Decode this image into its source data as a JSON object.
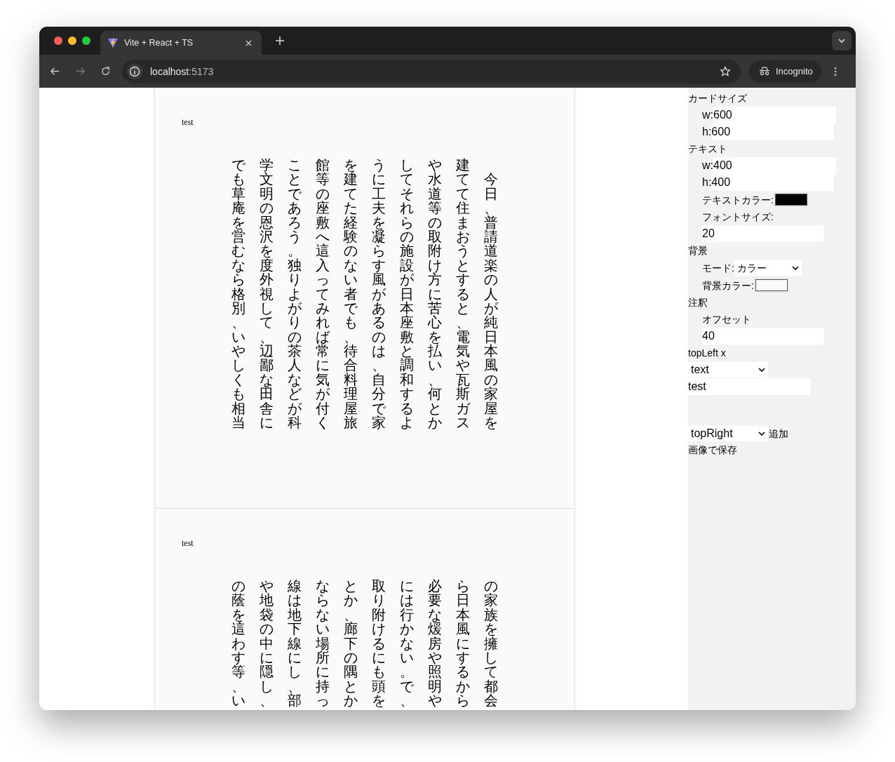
{
  "browser": {
    "tab_title": "Vite + React + TS",
    "url_host": "localhost",
    "url_port": ":5173",
    "profile": "Incognito"
  },
  "cards": [
    {
      "label": "test",
      "columns": [
        "でも草庵を営むなら格別、いやしくも相当",
        "学文明の恩沢を度外視して、辺鄙な田舎に",
        "ことであろう。独りよがりの茶人などが科",
        "館等の座敷へ這入ってみれば常に気が付く",
        "を建てた経験のない者でも、待合料理屋旅",
        "うに工夫を凝らす風があるのは、自分で家",
        "してそれらの施設が日本座敷と調和するよ",
        "や水道等の取附け方に苦心を払い、何とか",
        "建てて住まおうとすると、電気や瓦斯ガス",
        "　今日、普請道楽の人が純日本風の家屋を"
      ]
    },
    {
      "label": "test",
      "columns": [
        "の蔭を這わす等、い",
        "や地袋の中に隠し、",
        "線は地下線にし、部",
        "ならない場所に持っ",
        "とか、廊下の隅とか",
        "取り附けるにも頭を",
        "には行かない。で、",
        "必要な煖房や照明や",
        "ら日本風にするから",
        "の家族を擁して都会"
      ]
    }
  ],
  "panel": [
    {
      "kind": "heading",
      "text": "カードサイズ"
    },
    {
      "kind": "field",
      "label": "w:",
      "value": "600"
    },
    {
      "kind": "field",
      "label": "h:",
      "value": "600"
    },
    {
      "kind": "heading",
      "text": "テキスト"
    },
    {
      "kind": "field",
      "label": "w:",
      "value": "400"
    },
    {
      "kind": "field",
      "label": "h:",
      "value": "400"
    },
    {
      "kind": "color",
      "label": "テキストカラー:",
      "color": "#000000"
    },
    {
      "kind": "label",
      "text": "フォントサイズ:"
    },
    {
      "kind": "input",
      "value": "20"
    },
    {
      "kind": "heading",
      "text": "背景"
    },
    {
      "kind": "select",
      "label": "モード:",
      "value": "カラー"
    },
    {
      "kind": "color",
      "label": "背景カラー:",
      "color": "#fafafa"
    },
    {
      "kind": "heading",
      "text": "注釈"
    },
    {
      "kind": "label",
      "text": "オフセット"
    },
    {
      "kind": "input",
      "value": "40"
    },
    {
      "kind": "heading",
      "text": "topLeft x"
    },
    {
      "kind": "plain-select",
      "value": "text"
    },
    {
      "kind": "plain-input",
      "value": "test"
    },
    {
      "kind": "select-add",
      "value": "topRight",
      "button": "追加"
    },
    {
      "kind": "button",
      "text": "画像で保存"
    }
  ]
}
